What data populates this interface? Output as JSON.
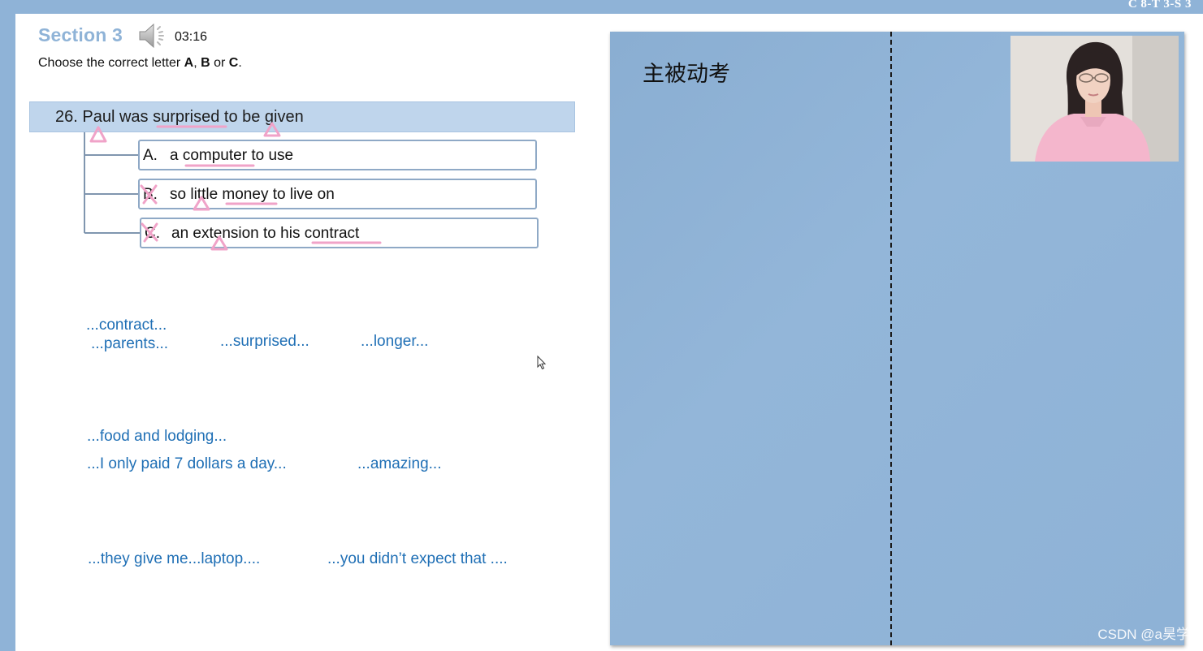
{
  "header": {
    "slide_label": "C 8-T 3-S 3"
  },
  "slide": {
    "section_title": "Section 3",
    "timer": "03:16",
    "instruction": {
      "prefix": "Choose the correct letter ",
      "a": "A",
      "sep1": ", ",
      "b": "B",
      "sep2": " or ",
      "c": "C",
      "end": "."
    },
    "question": "26. Paul was surprised to be given",
    "options": [
      {
        "letter": "A.",
        "text": "a computer to use"
      },
      {
        "letter": "B.",
        "text": "so little money to live on"
      },
      {
        "letter": "C.",
        "text": "an extension to his contract"
      }
    ],
    "keywords": {
      "contract": "...contract...",
      "parents": "...parents...",
      "surprised": "...surprised...",
      "longer": "...longer...",
      "food": "...food and lodging...",
      "paid": "...I only paid 7 dollars a day...",
      "amazing": "...amazing...",
      "laptop": "...they give me...laptop....",
      "expect": "...you didn’t expect that ...."
    }
  },
  "whiteboard": {
    "title": "主被动考"
  },
  "watermark": "CSDN @a昊学",
  "colors": {
    "accent_blue": "#8fb3d7",
    "keyword_blue": "#1f6fb5",
    "annotation_pink": "#f0a3c8"
  },
  "icons": [
    "speaker-icon",
    "cursor-icon",
    "cross-mark-icon",
    "triangle-mark-icon"
  ]
}
